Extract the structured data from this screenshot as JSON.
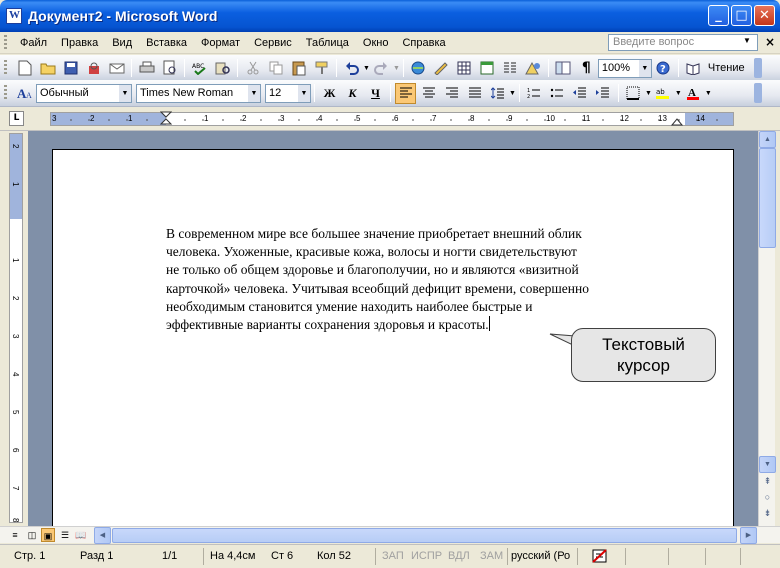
{
  "window": {
    "title": "Документ2 - Microsoft Word"
  },
  "menu": {
    "items": [
      "Файл",
      "Правка",
      "Вид",
      "Вставка",
      "Формат",
      "Сервис",
      "Таблица",
      "Окно",
      "Справка"
    ],
    "help_placeholder": "Введите вопрос"
  },
  "toolbar": {
    "zoom": "100%",
    "read_label": "Чтение"
  },
  "formatting": {
    "style": "Обычный",
    "font": "Times New Roman",
    "size": "12",
    "bold_label": "Ж",
    "italic_label": "К",
    "underline_label": "Ч"
  },
  "ruler": {
    "h_numbers": [
      "3",
      "2",
      "1",
      "1",
      "2",
      "3",
      "4",
      "5",
      "6",
      "7",
      "8",
      "9",
      "10",
      "11",
      "12",
      "13",
      "14"
    ],
    "v_numbers": [
      "2",
      "1",
      "1",
      "2",
      "3",
      "4",
      "5",
      "6",
      "7",
      "8"
    ]
  },
  "document": {
    "lines": [
      "В современном мире все большее значение приобретает внешний облик",
      "человека. Ухоженные, красивые кожа, волосы и ногти свидетельствуют",
      "не только об общем здоровье и благополучии, но и являются «визитной",
      "карточкой» человека. Учитывая всеобщий дефицит времени, совершенно",
      "необходимым становится умение находить наиболее быстрые и",
      "эффективные варианты сохранения здоровья и красоты."
    ]
  },
  "callout": {
    "line1": "Текстовый",
    "line2": "курсор"
  },
  "status": {
    "page": "Стр. 1",
    "section": "Разд 1",
    "pages": "1/1",
    "at": "На 4,4см",
    "line": "Ст 6",
    "col": "Кол 52",
    "rec": "ЗАП",
    "trk": "ИСПР",
    "ext": "ВДЛ",
    "ovr": "ЗАМ",
    "lang": "русский (Ро"
  }
}
